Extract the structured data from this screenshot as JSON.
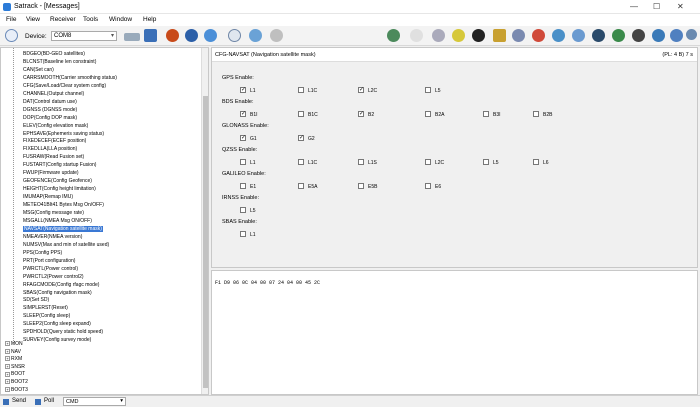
{
  "window": {
    "title": "Satrack - [Messages]",
    "minimize": "—",
    "maximize": "☐",
    "close": "✕"
  },
  "menu": [
    "File",
    "View",
    "Receiver",
    "Tools",
    "Window",
    "Help"
  ],
  "toolbar": {
    "device_label": "Device:",
    "device_value": "COM8"
  },
  "tree": {
    "items": [
      "BDGEO(BD-GEO satellites)",
      "BLCNST(Baseline len constraint)",
      "CAN(Set can)",
      "CARRSMOOTH(Carrier smoothing status)",
      "CFG(Save/Load/Clear system config)",
      "CHANNEL(Output channel)",
      "DAT(Control datum use)",
      "DGNSS (DGNSS mode)",
      "DOP(Config DOP mask)",
      "ELEV(Config elevation mask)",
      "EPHSAVE(Ephemeris saving status)",
      "FIXEDECEF(ECEF position)",
      "FIXEDLLA(LLA position)",
      "FUSRAW(Read Fusion set)",
      "FUSTART(Config startup Fusion)",
      "FWUP(Firmware update)",
      "GEOFENCE(Config Geofence)",
      "HEIGHT(Config height limitation)",
      "IMUMAP(Remap IMU)",
      "METEO41BIt41 Bytes Msg On/OFF)",
      "MSG(Config message rate)",
      "MSGALL(NMEA Msg ON/OFF)",
      "NAVSAT(Navigation satellite mask)",
      "NMEAVER(NMEA version)",
      "NUMSV(Max and min of satellite used)",
      "PPS(Config PPS)",
      "PRT(Port configuration)",
      "PWRCTL(Power control)",
      "PWRCTL2(Power control2)",
      "RFAGCMODE(Config rfagc mode)",
      "SBAS(Config navigation mask)",
      "SD(Set SD)",
      "SIMPLERST(Reset)",
      "SLEEP(Config sleep)",
      "SLEEP2(Config sleep expand)",
      "SPDHOLD(Query static hold speed)",
      "SURVEY(Config survey mode)"
    ],
    "selected_index": 22,
    "groups": [
      "MON",
      "NAV",
      "RXM",
      "SNSR",
      "BOOT",
      "BOOT2",
      "BOOT3"
    ]
  },
  "config": {
    "title": "CFG-NAVSAT (Navigation satellite mask)",
    "status": "(PL: 4 B)  7 s",
    "groups": [
      {
        "label": "GPS Enable:",
        "items": [
          {
            "name": "L1",
            "checked": true
          },
          {
            "name": "L1C",
            "checked": false
          },
          {
            "name": "L2C",
            "checked": true
          },
          {
            "name": "L5",
            "checked": false
          }
        ]
      },
      {
        "label": "BDS Enable:",
        "items": [
          {
            "name": "B1I",
            "checked": true
          },
          {
            "name": "B1C",
            "checked": false
          },
          {
            "name": "B2",
            "checked": true
          },
          {
            "name": "B2A",
            "checked": false
          },
          {
            "name": "B3I",
            "checked": false
          },
          {
            "name": "B2B",
            "checked": false
          }
        ]
      },
      {
        "label": "GLONASS Enable:",
        "items": [
          {
            "name": "G1",
            "checked": true
          },
          {
            "name": "G2",
            "checked": true
          }
        ]
      },
      {
        "label": "QZSS Enable:",
        "items": [
          {
            "name": "L1",
            "checked": false
          },
          {
            "name": "L1C",
            "checked": false
          },
          {
            "name": "L1S",
            "checked": false
          },
          {
            "name": "L2C",
            "checked": false
          },
          {
            "name": "L5",
            "checked": false
          },
          {
            "name": "L6",
            "checked": false
          }
        ]
      },
      {
        "label": "GALILEO Enable:",
        "items": [
          {
            "name": "E1",
            "checked": false
          },
          {
            "name": "E5A",
            "checked": false
          },
          {
            "name": "E5B",
            "checked": false
          },
          {
            "name": "E6",
            "checked": false
          }
        ]
      },
      {
        "label": "IRNSS Enable:",
        "items": [
          {
            "name": "L5",
            "checked": false
          }
        ]
      },
      {
        "label": "SBAS Enable:",
        "items": [
          {
            "name": "L1",
            "checked": false
          }
        ]
      }
    ]
  },
  "hex": "F1 D9 06 0C 04 00 07 24 04 00 45 2C",
  "statusbar": {
    "send": "Send",
    "poll": "Poll",
    "cmd": "CMD"
  }
}
